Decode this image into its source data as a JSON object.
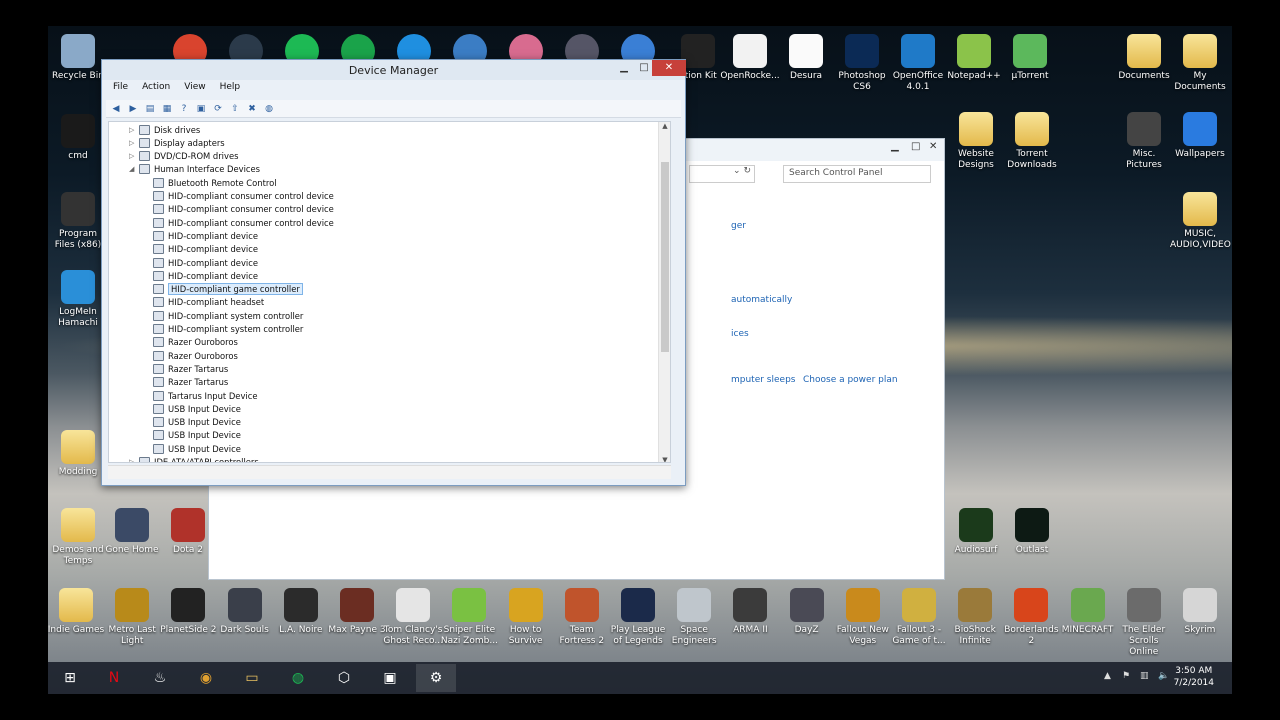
{
  "desktop": {
    "left_icons": [
      {
        "label": "Recycle Bin",
        "icon": "recycle-bin-icon",
        "color": "#8aa9c8"
      },
      {
        "label": "cmd",
        "icon": "cmd-icon",
        "color": "#1a1a1a"
      },
      {
        "label": "Program Files (x86)",
        "icon": "unity-icon",
        "color": "#333"
      },
      {
        "label": "LogMeIn Hamachi",
        "icon": "hamachi-icon",
        "color": "#2a8fd8"
      },
      {
        "label": "Modding",
        "icon": "folder-icon",
        "color": ""
      },
      {
        "label": "Demos and Temps",
        "icon": "folder-icon",
        "color": ""
      },
      {
        "label": "Gone Home",
        "icon": "gone-home-icon",
        "color": "#3b4a66"
      },
      {
        "label": "Dota 2",
        "icon": "dota2-icon",
        "color": "#b0322a"
      }
    ],
    "top_icons": [
      {
        "label": "ation Kit",
        "icon": "creation-kit-icon",
        "color": "#222"
      },
      {
        "label": "OpenRocke...",
        "icon": "java-icon",
        "color": "#f2f2f2"
      },
      {
        "label": "Desura",
        "icon": "desura-icon",
        "color": "#fafafa"
      },
      {
        "label": "Photoshop CS6",
        "icon": "photoshop-icon",
        "color": "#0b2a55"
      },
      {
        "label": "OpenOffice 4.0.1",
        "icon": "openoffice-icon",
        "color": "#1f7ac8"
      },
      {
        "label": "Notepad++",
        "icon": "notepad-icon",
        "color": "#8bc34a"
      },
      {
        "label": "µTorrent",
        "icon": "utorrent-icon",
        "color": "#5cb85c"
      }
    ],
    "right_icons": [
      {
        "label": "Documents",
        "icon": "folder-icon",
        "color": ""
      },
      {
        "label": "My Documents",
        "icon": "folder-icon",
        "color": ""
      },
      {
        "label": "Website Designs",
        "icon": "folder-icon",
        "color": ""
      },
      {
        "label": "Torrent Downloads",
        "icon": "folder-icon",
        "color": ""
      },
      {
        "label": "Misc. Pictures",
        "icon": "film-icon",
        "color": "#444"
      },
      {
        "label": "Wallpapers",
        "icon": "image-icon",
        "color": "#2a7be0"
      },
      {
        "label": "MUSIC, AUDIO,VIDEO",
        "icon": "folder-icon",
        "color": ""
      },
      {
        "label": "Audiosurf",
        "icon": "audiosurf-icon",
        "color": "#1b3a1b"
      },
      {
        "label": "Outlast",
        "icon": "outlast-icon",
        "color": "#0d1a14"
      }
    ],
    "bottom_icons": [
      {
        "label": "Indie Games",
        "icon": "folder-icon",
        "color": ""
      },
      {
        "label": "Metro Last Light",
        "icon": "metro-icon",
        "color": "#b88a1a"
      },
      {
        "label": "PlanetSide 2",
        "icon": "planetside-icon",
        "color": "#222"
      },
      {
        "label": "Dark Souls",
        "icon": "dark-souls-icon",
        "color": "#3a3f4a"
      },
      {
        "label": "L.A. Noire",
        "icon": "la-noire-icon",
        "color": "#2b2b2b"
      },
      {
        "label": "Max Payne 3",
        "icon": "max-payne-icon",
        "color": "#6b2d22"
      },
      {
        "label": "Tom Clancy's Ghost Reco...",
        "icon": "ghost-recon-icon",
        "color": "#e5e5e5"
      },
      {
        "label": "Sniper Elite Nazi Zomb...",
        "icon": "sniper-elite-icon",
        "color": "#7ac142"
      },
      {
        "label": "How to Survive",
        "icon": "how-to-survive-icon",
        "color": "#d8a420"
      },
      {
        "label": "Team Fortress 2",
        "icon": "tf2-icon",
        "color": "#c0542c"
      },
      {
        "label": "Play League of Legends",
        "icon": "lol-icon",
        "color": "#1b2a4a"
      },
      {
        "label": "Space Engineers",
        "icon": "space-engineers-icon",
        "color": "#bfc6cc"
      },
      {
        "label": "ARMA II",
        "icon": "arma-icon",
        "color": "#3b3b3b"
      },
      {
        "label": "DayZ",
        "icon": "dayz-icon",
        "color": "#4a4a55"
      },
      {
        "label": "Fallout New Vegas",
        "icon": "fallout-nv-icon",
        "color": "#c98a1c"
      },
      {
        "label": "Fallout 3 - Game of t...",
        "icon": "fallout3-icon",
        "color": "#d0b040"
      },
      {
        "label": "BioShock Infinite",
        "icon": "bioshock-icon",
        "color": "#9a7a3a"
      },
      {
        "label": "Borderlands 2",
        "icon": "borderlands-icon",
        "color": "#d8451b"
      },
      {
        "label": "MINECRAFT",
        "icon": "minecraft-icon",
        "color": "#6aa84f"
      },
      {
        "label": "The Elder Scrolls Online",
        "icon": "eso-icon",
        "color": "#6b6b6b"
      },
      {
        "label": "Skyrim",
        "icon": "skyrim-icon",
        "color": "#d6d6d6"
      }
    ],
    "top_row_apps": [
      "Chrome",
      "Steam",
      "Spotify",
      "Razer",
      "Skype",
      "Hamachi",
      "Picasa",
      "Gadget",
      "iTunes"
    ]
  },
  "control_panel": {
    "search_placeholder": "Search Control Panel",
    "links": [
      "ger",
      "automatically",
      "ices",
      "mputer sleeps",
      "Choose a power plan"
    ]
  },
  "device_manager": {
    "title": "Device Manager",
    "menu": [
      "File",
      "Action",
      "View",
      "Help"
    ],
    "tree": [
      {
        "label": "Disk drives",
        "level": 0,
        "arrow": "▷"
      },
      {
        "label": "Display adapters",
        "level": 0,
        "arrow": "▷"
      },
      {
        "label": "DVD/CD-ROM drives",
        "level": 0,
        "arrow": "▷"
      },
      {
        "label": "Human Interface Devices",
        "level": 0,
        "arrow": "◢"
      },
      {
        "label": "Bluetooth Remote Control",
        "level": 1
      },
      {
        "label": "HID-compliant consumer control device",
        "level": 1
      },
      {
        "label": "HID-compliant consumer control device",
        "level": 1
      },
      {
        "label": "HID-compliant consumer control device",
        "level": 1
      },
      {
        "label": "HID-compliant device",
        "level": 1
      },
      {
        "label": "HID-compliant device",
        "level": 1
      },
      {
        "label": "HID-compliant device",
        "level": 1
      },
      {
        "label": "HID-compliant device",
        "level": 1
      },
      {
        "label": "HID-compliant game controller",
        "level": 1,
        "selected": true
      },
      {
        "label": "HID-compliant headset",
        "level": 1
      },
      {
        "label": "HID-compliant system controller",
        "level": 1
      },
      {
        "label": "HID-compliant system controller",
        "level": 1
      },
      {
        "label": "Razer Ouroboros",
        "level": 1
      },
      {
        "label": "Razer Ouroboros",
        "level": 1
      },
      {
        "label": "Razer Tartarus",
        "level": 1
      },
      {
        "label": "Razer Tartarus",
        "level": 1
      },
      {
        "label": "Tartarus Input Device",
        "level": 1
      },
      {
        "label": "USB Input Device",
        "level": 1
      },
      {
        "label": "USB Input Device",
        "level": 1
      },
      {
        "label": "USB Input Device",
        "level": 1
      },
      {
        "label": "USB Input Device",
        "level": 1
      },
      {
        "label": "IDE ATA/ATAPI controllers",
        "level": 0,
        "arrow": "▷"
      }
    ]
  },
  "taskbar": {
    "apps": [
      "windows-start",
      "netflix",
      "steam",
      "chrome",
      "file-explorer",
      "spotify",
      "hamachi",
      "remote-desktop",
      "device-manager"
    ],
    "time": "3:50 AM",
    "date": "7/2/2014"
  }
}
